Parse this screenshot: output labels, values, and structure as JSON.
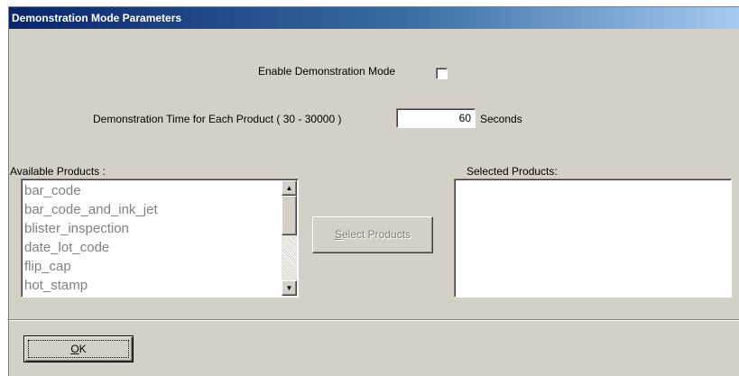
{
  "window": {
    "title": "Demonstration Mode Parameters"
  },
  "enable_demo": {
    "label": "Enable Demonstration Mode",
    "checked": false
  },
  "demo_time": {
    "label": "Demonstration Time for Each Product  ( 30 - 30000 )",
    "value": "60",
    "unit": "Seconds"
  },
  "available_products": {
    "label": "Available Products :",
    "items": [
      "bar_code",
      "bar_code_and_ink_jet",
      "blister_inspection",
      "date_lot_code",
      "flip_cap",
      "hot_stamp"
    ]
  },
  "select_button": {
    "mnemonic": "S",
    "rest": "elect Products"
  },
  "selected_products": {
    "label": "Selected Products:",
    "items": []
  },
  "ok_button": {
    "mnemonic": "O",
    "rest": "K"
  }
}
